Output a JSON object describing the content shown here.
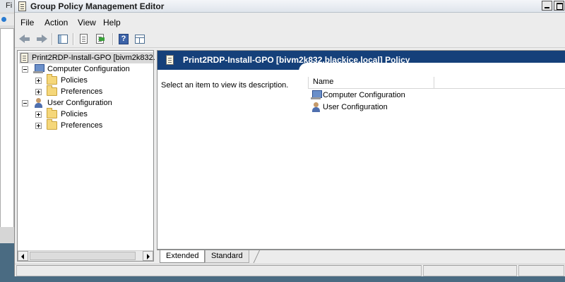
{
  "background_app": {
    "title_fragment": "Fi"
  },
  "window": {
    "title": "Group Policy Management Editor"
  },
  "menu": {
    "items": [
      "File",
      "Action",
      "View",
      "Help"
    ]
  },
  "toolbar": {
    "buttons": [
      "back-icon",
      "forward-icon",
      "show-hide-console-tree-icon",
      "properties-icon",
      "export-list-icon",
      "help-icon",
      "show-hide-action-pane-icon"
    ]
  },
  "tree": {
    "root_label": "Print2RDP-Install-GPO [bivm2k832.",
    "computer_config": {
      "label": "Computer Configuration",
      "children": [
        "Policies",
        "Preferences"
      ]
    },
    "user_config": {
      "label": "User Configuration",
      "children": [
        "Policies",
        "Preferences"
      ]
    }
  },
  "details": {
    "header_title": "Print2RDP-Install-GPO [bivm2k832.blackice.local] Policy",
    "description": "Select an item to view its description.",
    "column_name": "Name",
    "items": [
      "Computer Configuration",
      "User Configuration"
    ]
  },
  "tabs": {
    "extended": "Extended",
    "standard": "Standard"
  },
  "colors": {
    "header_blue": "#15407a",
    "desktop": "#4a6b82"
  }
}
